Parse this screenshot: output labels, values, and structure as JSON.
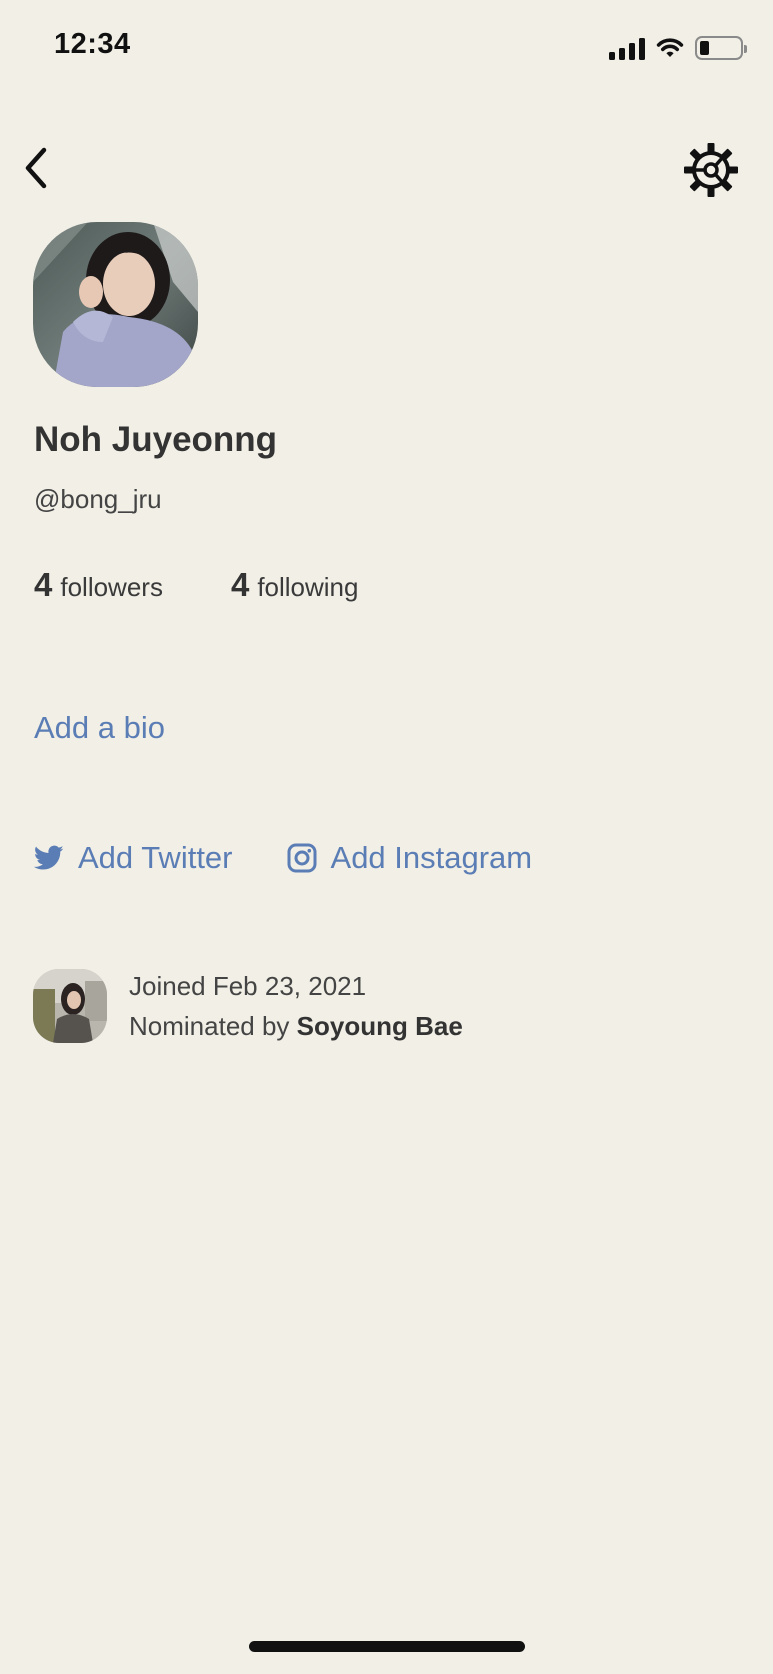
{
  "status_bar": {
    "time": "12:34",
    "icons": [
      "signal-icon",
      "wifi-icon",
      "battery-icon"
    ]
  },
  "nav": {
    "back_icon": "chevron-left-icon",
    "settings_icon": "gear-icon"
  },
  "profile": {
    "name": "Noh Juyeonng",
    "username": "@bong_jru",
    "followers_count": "4",
    "followers_label": "followers",
    "following_count": "4",
    "following_label": "following",
    "add_bio": "Add a bio"
  },
  "socials": {
    "twitter_label": "Add Twitter",
    "twitter_icon": "twitter-icon",
    "instagram_label": "Add Instagram",
    "instagram_icon": "instagram-icon"
  },
  "joined": {
    "date_text": "Joined Feb 23, 2021",
    "nominated_prefix": "Nominated by",
    "nominated_by": "Soyoung Bae"
  },
  "colors": {
    "background": "#f1efe6",
    "link": "#5b7db5",
    "text": "#333333"
  }
}
